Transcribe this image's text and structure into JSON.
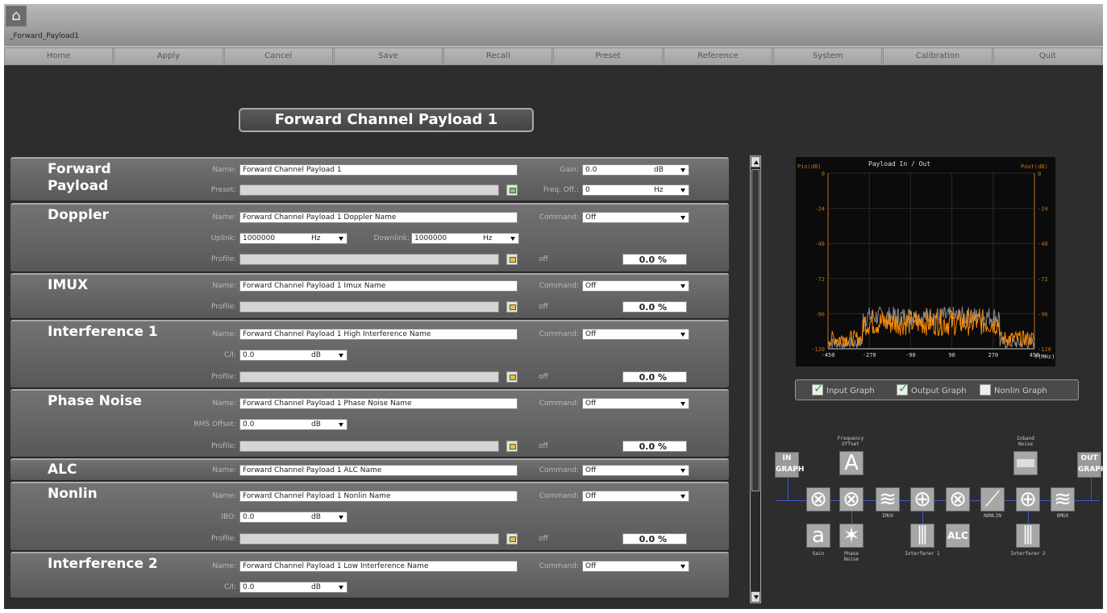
{
  "window": {
    "title": "_Forward_Payload1"
  },
  "menu": [
    "Home",
    "Apply",
    "Cancel",
    "Save",
    "Recall",
    "Preset",
    "Reference",
    "System",
    "Calibration",
    "Quit"
  ],
  "panel_title": "Forward Channel Payload 1",
  "labels": {
    "name": "Name:",
    "preset": "Preset:",
    "gain": "Gain:",
    "freq_off": "Freq. Off.:",
    "command": "Command:",
    "uplink": "Uplink:",
    "downlink": "Downlink:",
    "profile": "Profile:",
    "ci": "C/I:",
    "rms_offset": "RMS Offset:",
    "ibo": "IBO:",
    "off": "off"
  },
  "units": {
    "db": "dB",
    "hz": "Hz"
  },
  "sections": {
    "forward": {
      "title": "Forward Payload",
      "name": "Forward Channel Payload 1",
      "gain": "0.0",
      "freq_off": "0"
    },
    "doppler": {
      "title": "Doppler",
      "name": "Forward Channel Payload 1 Doppler Name",
      "command": "Off",
      "uplink": "1000000",
      "downlink": "1000000",
      "percent": "0.0 %"
    },
    "imux": {
      "title": "IMUX",
      "name": "Forward Channel Payload 1 Imux Name",
      "command": "Off",
      "percent": "0.0 %"
    },
    "interference1": {
      "title": "Interference 1",
      "name": "Forward Channel Payload 1 High Interference Name",
      "command": "Off",
      "ci": "0.0",
      "percent": "0.0 %"
    },
    "phase_noise": {
      "title": "Phase Noise",
      "name": "Forward Channel Payload 1 Phase Noise Name",
      "command": "Off",
      "rms_offset": "0.0",
      "percent": "0.0 %"
    },
    "alc": {
      "title": "ALC",
      "name": "Forward Channel Payload 1 ALC Name",
      "command": "Off"
    },
    "nonlin": {
      "title": "Nonlin",
      "name": "Forward Channel Payload 1 Nonlin Name",
      "command": "Off",
      "ibo": "0.0",
      "percent": "0.0 %"
    },
    "interference2": {
      "title": "Interference 2",
      "name": "Forward Channel Payload 1 Low Interference Name",
      "command": "Off",
      "ci": "0.0"
    }
  },
  "graph": {
    "title": "Payload In / Out",
    "left_label": "Pin(dB)",
    "right_label": "Pout(dB)",
    "x_label": "f(MHz)",
    "y_ticks": [
      "0",
      "-24",
      "-48",
      "-72",
      "-96",
      "-120"
    ],
    "x_ticks": [
      "-450",
      "-270",
      "-90",
      "90",
      "270",
      "450"
    ],
    "colors": {
      "input": "#ff8c00",
      "output": "#8a8a8a",
      "axis": "#c07020"
    },
    "chart_data": {
      "type": "line",
      "x_range": [
        -450,
        450
      ],
      "y_range": [
        -120,
        0
      ],
      "series": [
        {
          "name": "Input Graph",
          "note": "noise floor ~-115 dB, passband -300..300 MHz at ~-96 dB"
        },
        {
          "name": "Output Graph"
        }
      ]
    }
  },
  "checks": [
    {
      "label": "Input Graph",
      "checked": true
    },
    {
      "label": "Output Graph",
      "checked": true
    },
    {
      "label": "Nonlin Graph",
      "checked": false
    }
  ],
  "blocks": {
    "in": "IN GRAPH",
    "out": "OUT GRAPH",
    "freq_offset": "Frequency Offset",
    "inband_noise": "Inband Noise",
    "imux": "IMUX",
    "nonlin": "NONLIN",
    "omux": "OMUX",
    "gain": "Gain",
    "phase_noise": "Phase Noise",
    "interferer1": "Interferer 1",
    "interferer2": "Interferer 2",
    "alc": "ALC",
    "a": "a"
  }
}
